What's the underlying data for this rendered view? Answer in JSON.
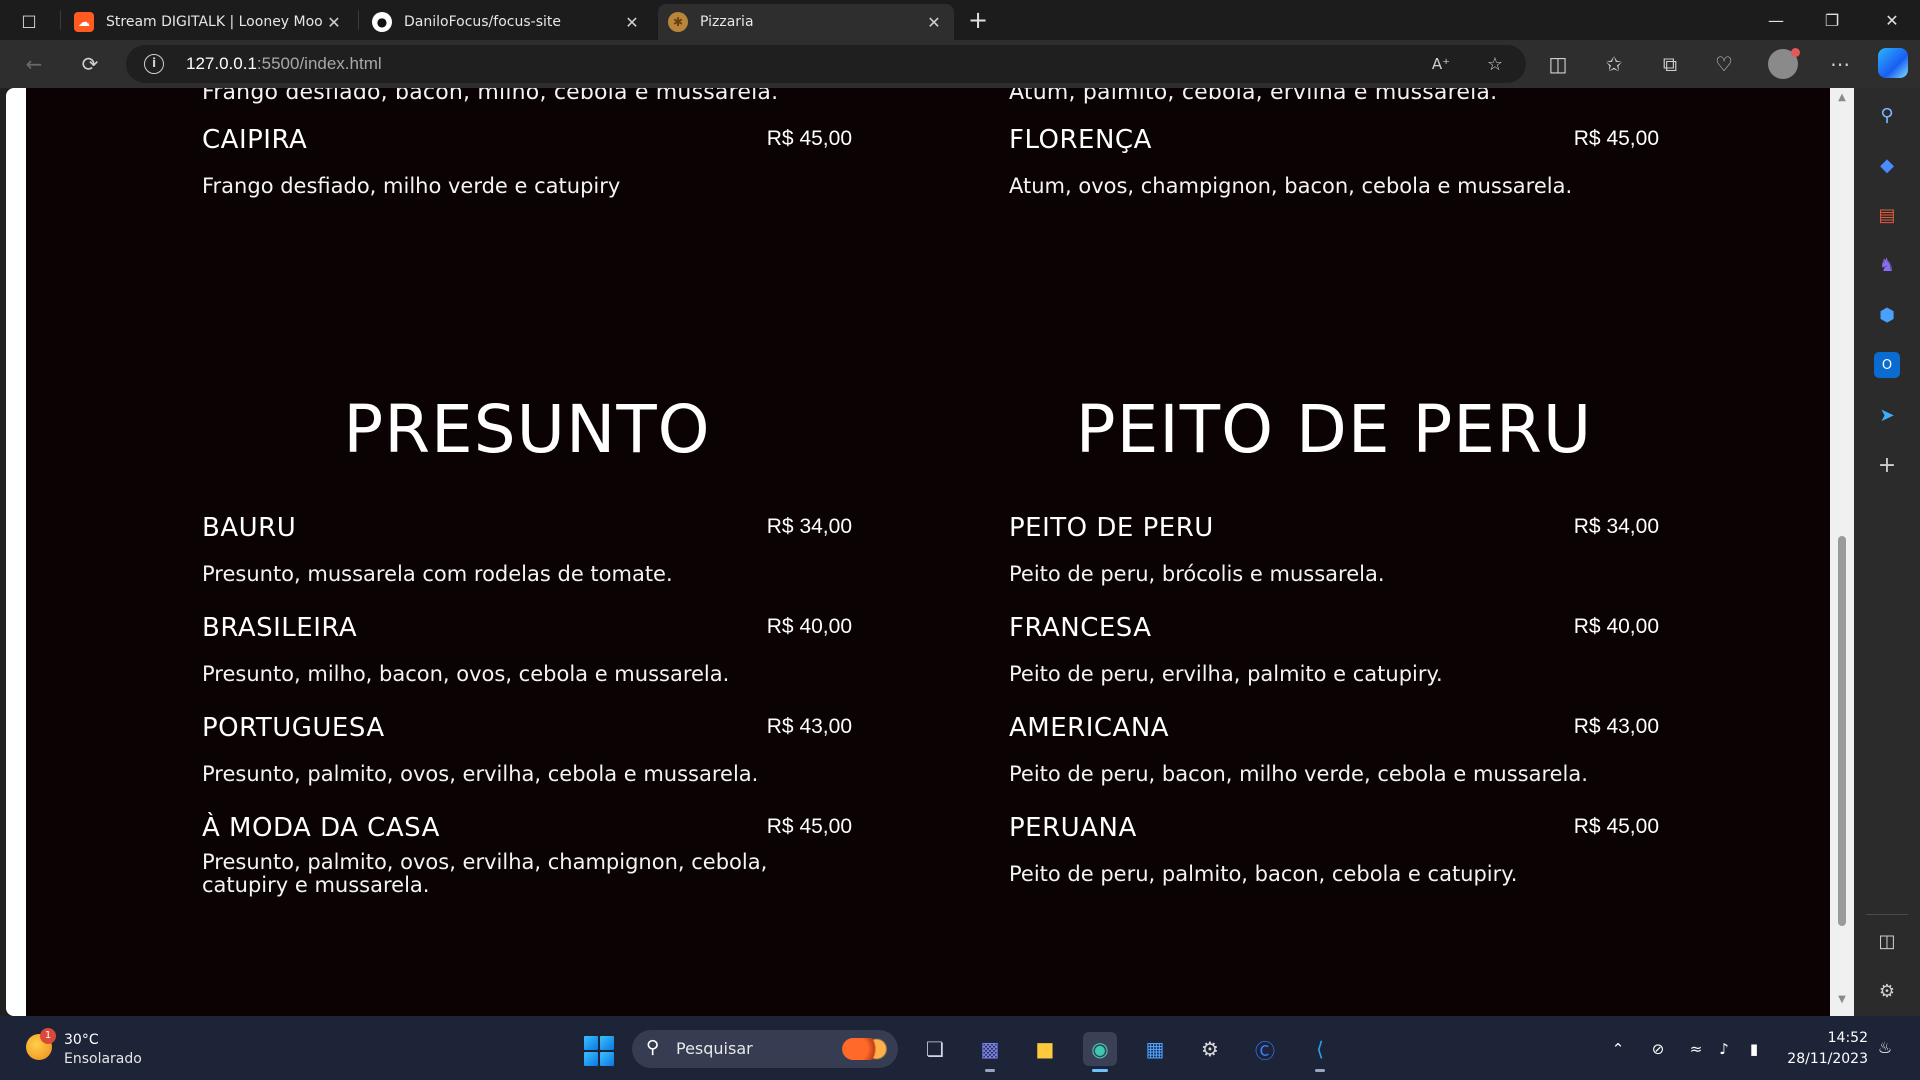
{
  "browser": {
    "tabs": [
      {
        "title": "Stream DIGITALK | Looney Moon",
        "icon": "soundcloud-icon",
        "active": false
      },
      {
        "title": "DaniloFocus/focus-site",
        "icon": "github-icon",
        "active": false
      },
      {
        "title": "Pizzaria",
        "icon": "pizza-icon",
        "active": true
      }
    ],
    "url_host": "127.0.0.1",
    "url_path": ":5500/index.html"
  },
  "menu": {
    "cut_off": {
      "left": "Frango desfiado, bacon, milho, cebola e mussarela.",
      "right": "Atum, palmito, cebola, ervilha e mussarela."
    },
    "top_items": [
      {
        "name": "CAIPIRA",
        "price": "R$ 45,00",
        "description": "Frango desfiado, milho verde e catupiry"
      },
      {
        "name": "FLORENÇA",
        "price": "R$ 45,00",
        "description": "Atum, ovos, champignon, bacon, cebola e mussarela."
      }
    ],
    "sections": [
      {
        "title": "PRESUNTO",
        "items": [
          {
            "name": "BAURU",
            "price": "R$ 34,00",
            "description": "Presunto, mussarela com rodelas de tomate."
          },
          {
            "name": "BRASILEIRA",
            "price": "R$ 40,00",
            "description": "Presunto, milho, bacon, ovos, cebola e mussarela."
          },
          {
            "name": "PORTUGUESA",
            "price": "R$ 43,00",
            "description": "Presunto, palmito, ovos, ervilha, cebola e mussarela."
          },
          {
            "name": "À MODA DA CASA",
            "price": "R$ 45,00",
            "description": "Presunto, palmito, ovos, ervilha, champignon, cebola, catupiry e mussarela."
          }
        ]
      },
      {
        "title": "PEITO DE PERU",
        "items": [
          {
            "name": "PEITO DE PERU",
            "price": "R$ 34,00",
            "description": "Peito de peru, brócolis e mussarela."
          },
          {
            "name": "FRANCESA",
            "price": "R$ 40,00",
            "description": "Peito de peru, ervilha, palmito e catupiry."
          },
          {
            "name": "AMERICANA",
            "price": "R$ 43,00",
            "description": "Peito de peru, bacon, milho verde, cebola e mussarela."
          },
          {
            "name": "PERUANA",
            "price": "R$ 45,00",
            "description": "Peito de peru, palmito, bacon, cebola e catupiry."
          }
        ]
      }
    ]
  },
  "taskbar": {
    "weather_temp": "30°C",
    "weather_desc": "Ensolarado",
    "weather_badge": "1",
    "search_placeholder": "Pesquisar",
    "time": "14:52",
    "date": "28/11/2023"
  }
}
